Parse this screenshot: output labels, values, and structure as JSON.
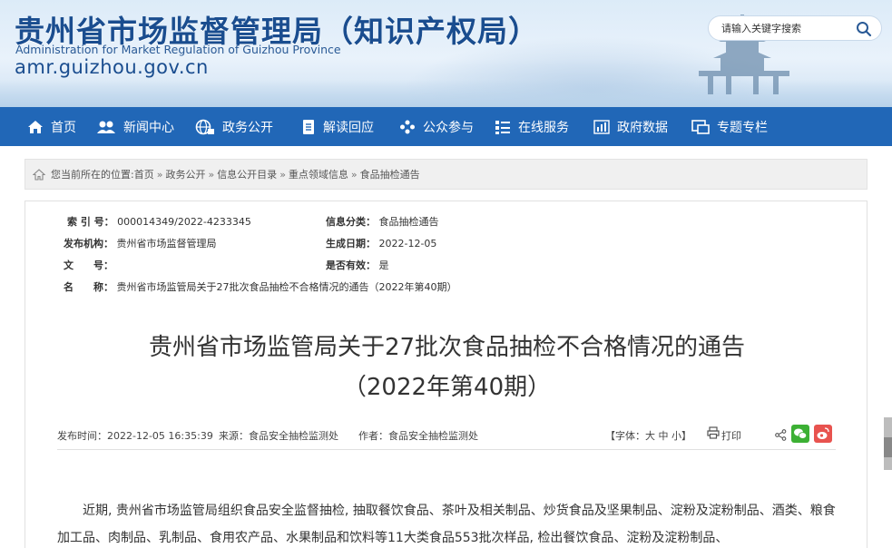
{
  "header": {
    "title_cn": "贵州省市场监督管理局（知识产权局）",
    "title_en": "Administration for Market Regulation of Guizhou Province",
    "url": "amr.guizhou.gov.cn",
    "search_placeholder": "请输入关键字搜索",
    "search_icon": "search-icon"
  },
  "nav": {
    "items": [
      {
        "label": "首页",
        "icon": "home-icon"
      },
      {
        "label": "新闻中心",
        "icon": "people-icon"
      },
      {
        "label": "政务公开",
        "icon": "globe-icon"
      },
      {
        "label": "解读回应",
        "icon": "document-icon"
      },
      {
        "label": "公众参与",
        "icon": "users-icon"
      },
      {
        "label": "在线服务",
        "icon": "list-icon"
      },
      {
        "label": "政府数据",
        "icon": "chart-icon"
      },
      {
        "label": "专题专栏",
        "icon": "window-icon"
      }
    ],
    "color": "#2167b7"
  },
  "breadcrumb": {
    "prefix": "您当前所在的位置:",
    "items": [
      "首页",
      "政务公开",
      "信息公开目录",
      "重点领域信息",
      "食品抽检通告"
    ],
    "separator": "»"
  },
  "meta": {
    "index_label": "索 引 号：",
    "index_value": "000014349/2022-4233345",
    "category_label": "信息分类：",
    "category_value": "食品抽检通告",
    "org_label": "发布机构：",
    "org_value": "贵州省市场监督管理局",
    "date_label": "生成日期：",
    "date_value": "2022-12-05",
    "docno_label": "文　　号：",
    "docno_value": "",
    "valid_label": "是否有效：",
    "valid_value": "是",
    "name_label": "名　　称：",
    "name_value": "贵州省市场监管局关于27批次食品抽检不合格情况的通告（2022年第40期）"
  },
  "article": {
    "title_line1": "贵州省市场监管局关于27批次食品抽检不合格情况的通告",
    "title_line2": "（2022年第40期）",
    "publish_time": "发布时间：2022-12-05 16:35:39",
    "source": "来源：食品安全抽检监测处",
    "author": "作者：食品安全抽检监测处",
    "font_size_label": "【字体：大 中 小】",
    "print_label": "打印",
    "paragraph": "近期, 贵州省市场监管局组织食品安全监督抽检, 抽取餐饮食品、茶叶及相关制品、炒货食品及坚果制品、淀粉及淀粉制品、酒类、粮食加工品、肉制品、乳制品、食用农产品、水果制品和饮料等11大类食品553批次样品, 检出餐饮食品、淀粉及淀粉制品、"
  }
}
